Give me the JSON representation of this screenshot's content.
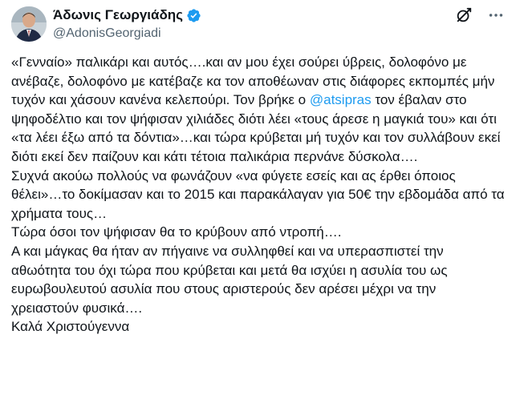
{
  "author": {
    "display_name": "Άδωνις Γεωργιάδης",
    "handle": "@AdonisGeorgiadi",
    "verified_icon": "verified-badge-icon",
    "avatar_icon": "avatar"
  },
  "actions": {
    "grok_icon": "grok-icon",
    "more_icon": "more-icon"
  },
  "colors": {
    "text": "#0f1419",
    "secondary": "#536471",
    "link": "#1d9bf0"
  },
  "tweet": {
    "p1_before_mention": "«Γενναίο» παλικάρι και αυτός….και αν μου έχει σούρει ύβρεις, δολοφόνο με ανέβαζε, δολοφόνο με κατέβαζε κα τον αποθέωναν στις διάφορες εκπομπές μήν τυχόν και χάσουν κανένα κελεπούρι. Τον βρήκε ο ",
    "mention": "@atsipras",
    "p1_after_mention": " τον έβαλαν στο ψηφοδέλτιο και τον ψήφισαν χιλιάδες διότι λέει «τους άρεσε η μαγκιά του» και ότι «τα λέει έξω από τα δόντια»…και τώρα κρύβεται μή τυχόν και τον συλλάβουν εκεί διότι εκεί δεν παίζουν και κάτι τέτοια παλικάρια περνάνε δύσκολα….",
    "p2": "Συχνά ακούω πολλούς να φωνάζουν «να φύγετε εσείς και ας έρθει όποιος θέλει»…το δοκίμασαν και το 2015 και παρακάλαγαν για 50€ την εβδομάδα από τα χρήματα τους…",
    "p3": "Τώρα όσοι τον ψήφισαν θα το κρύβουν από ντροπή….",
    "p4": "Α και μάγκας θα ήταν αν πήγαινε να συλληφθεί και να υπερασπιστεί την αθωότητα του όχι τώρα που κρύβεται και μετά θα ισχύει η ασυλία του ως ευρωβουλευτού ασυλία που στους αριστερούς δεν αρέσει μέχρι να την χρειαστούν φυσικά….",
    "p5": "Καλά Χριστούγεννα"
  }
}
